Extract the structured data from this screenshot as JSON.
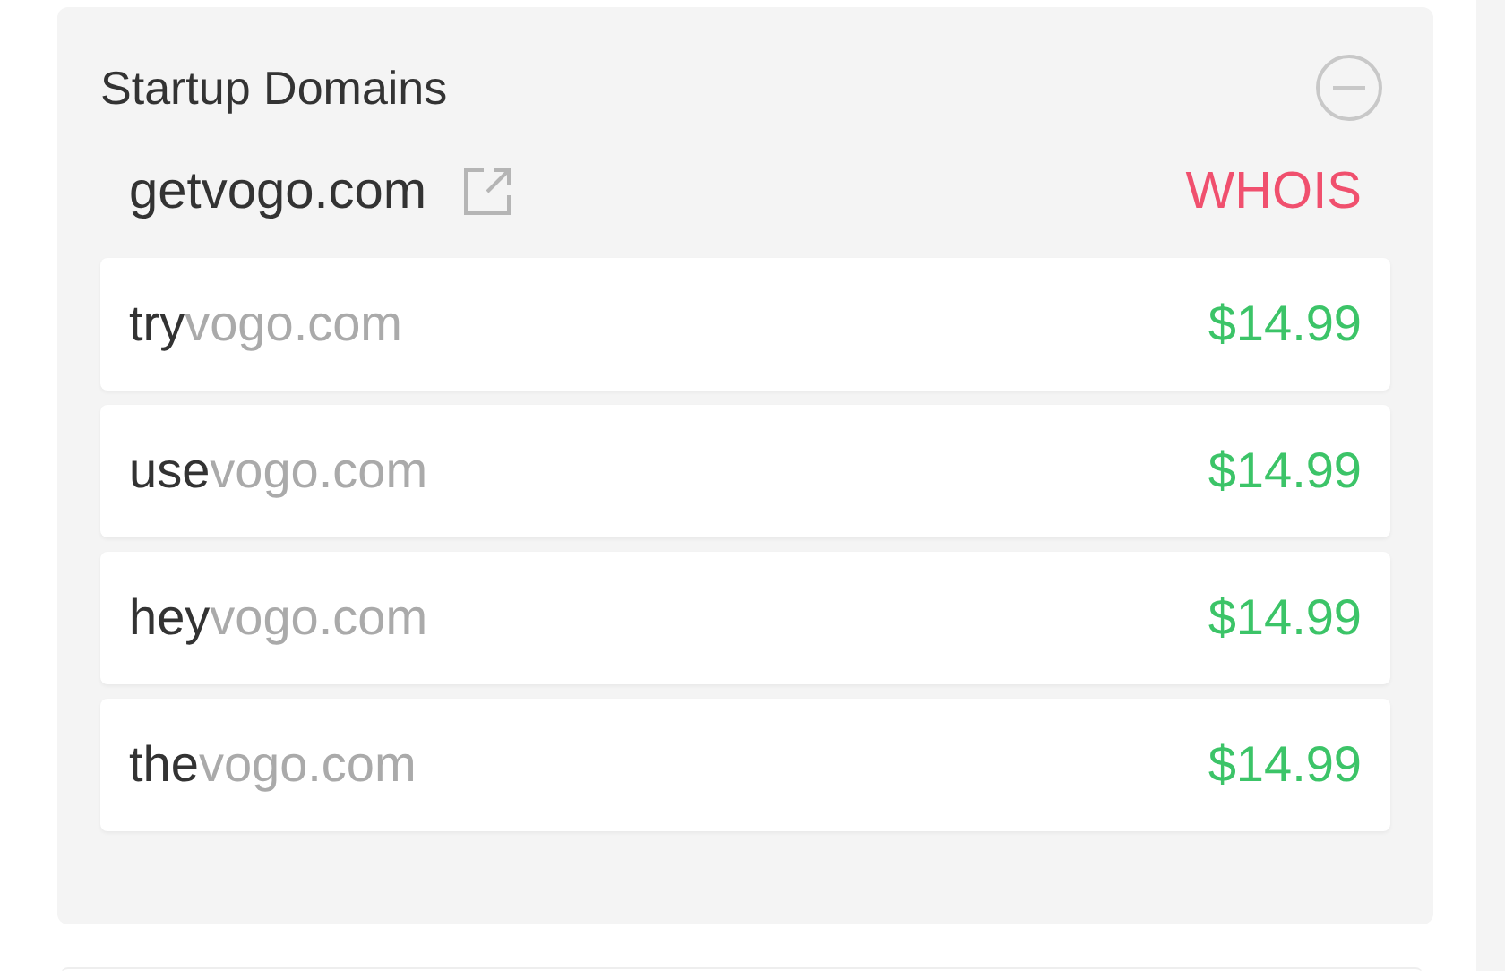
{
  "panel": {
    "title": "Startup Domains",
    "domain": "getvogo.com",
    "whois": "WHOIS"
  },
  "suggestions": [
    {
      "prefix": "try",
      "suffix": "vogo.com",
      "price": "$14.99"
    },
    {
      "prefix": "use",
      "suffix": "vogo.com",
      "price": "$14.99"
    },
    {
      "prefix": "hey",
      "suffix": "vogo.com",
      "price": "$14.99"
    },
    {
      "prefix": "the",
      "suffix": "vogo.com",
      "price": "$14.99"
    }
  ]
}
